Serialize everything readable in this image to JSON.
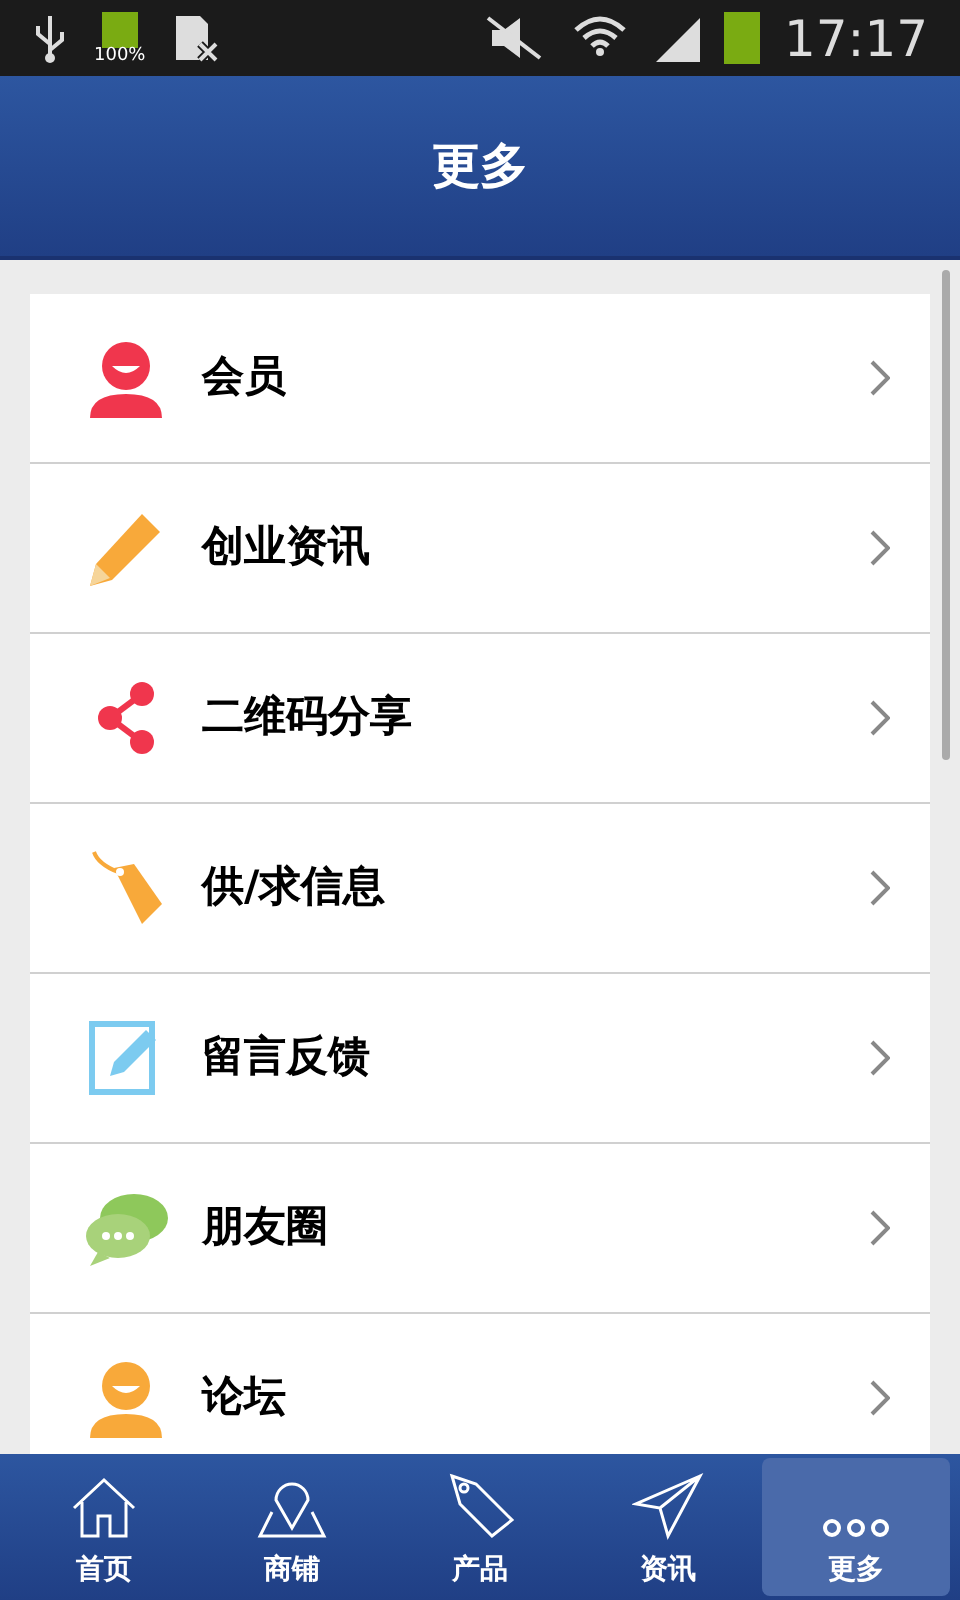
{
  "status_bar": {
    "battery_text": "100%",
    "time": "17:17"
  },
  "header": {
    "title": "更多"
  },
  "menu": [
    {
      "label": "会员",
      "kind": "member"
    },
    {
      "label": "创业资讯",
      "kind": "pencil"
    },
    {
      "label": "二维码分享",
      "kind": "share"
    },
    {
      "label": "供/求信息",
      "kind": "tag"
    },
    {
      "label": "留言反馈",
      "kind": "edit"
    },
    {
      "label": "朋友圈",
      "kind": "chat"
    },
    {
      "label": "论坛",
      "kind": "forum"
    }
  ],
  "tab_bar": [
    {
      "label": "首页",
      "kind": "home",
      "selected": false
    },
    {
      "label": "商铺",
      "kind": "map",
      "selected": false
    },
    {
      "label": "产品",
      "kind": "tag",
      "selected": false
    },
    {
      "label": "资讯",
      "kind": "plane",
      "selected": false
    },
    {
      "label": "更多",
      "kind": "dots",
      "selected": true
    }
  ]
}
